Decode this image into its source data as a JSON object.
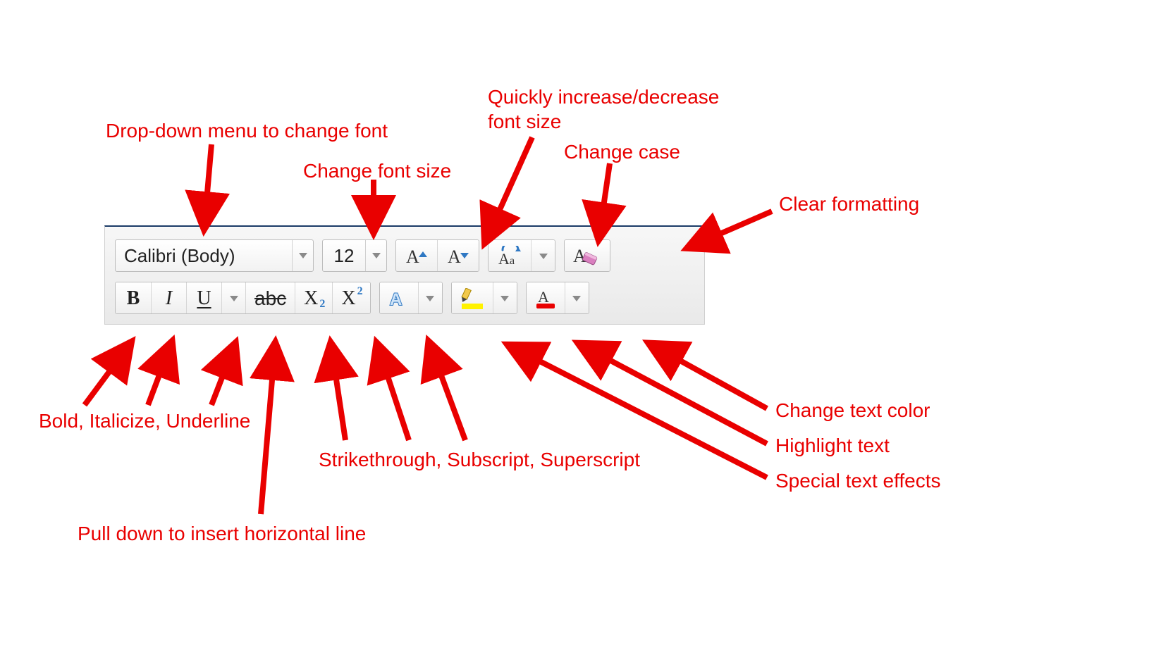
{
  "toolbar": {
    "font_name": "Calibri (Body)",
    "font_size": "12"
  },
  "callouts": {
    "font_dropdown": "Drop-down menu to change font",
    "change_font_size": "Change font size",
    "inc_dec_size_line1": "Quickly increase/decrease",
    "inc_dec_size_line2": "font size",
    "change_case": "Change case",
    "clear_formatting": "Clear formatting",
    "bold_italic_underline": "Bold, Italicize, Underline",
    "hline_pulldown": "Pull down to insert horizontal line",
    "strike_sub_super": "Strikethrough, Subscript, Superscript",
    "text_color": "Change text color",
    "highlight": "Highlight text",
    "text_effects": "Special text effects"
  }
}
